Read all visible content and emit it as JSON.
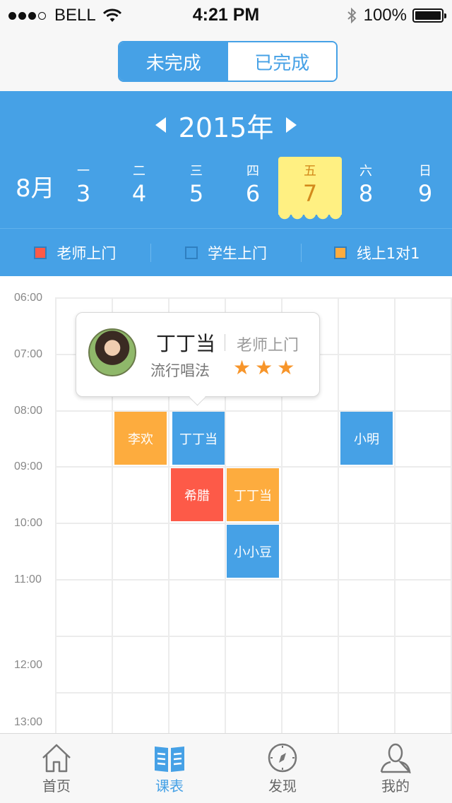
{
  "status_bar": {
    "carrier": "BELL",
    "time": "4:21 PM",
    "battery": "100%"
  },
  "segmented": {
    "options": [
      "未完成",
      "已完成"
    ],
    "selected": "未完成"
  },
  "calendar": {
    "year": "2015年",
    "month": "8月",
    "days": [
      {
        "weekday": "一",
        "date": "3"
      },
      {
        "weekday": "二",
        "date": "4"
      },
      {
        "weekday": "三",
        "date": "5"
      },
      {
        "weekday": "四",
        "date": "6"
      },
      {
        "weekday": "五",
        "date": "7"
      },
      {
        "weekday": "六",
        "date": "8"
      },
      {
        "weekday": "日",
        "date": "9"
      }
    ],
    "selected_day": "7"
  },
  "legend": [
    {
      "label": "老师上门",
      "color": "#fd5a48"
    },
    {
      "label": "学生上门",
      "color": "#46a1e6"
    },
    {
      "label": "线上1对1",
      "color": "#fdac3e"
    }
  ],
  "schedule": {
    "times": [
      "06:00",
      "07:00",
      "08:00",
      "09:00",
      "10:00",
      "11:00",
      "12:00",
      "13:00"
    ],
    "events": [
      {
        "name": "李欢",
        "type": "线上1对1",
        "color": "#fdac3e"
      },
      {
        "name": "丁丁当",
        "type": "学生上门",
        "color": "#46a1e6"
      },
      {
        "name": "小明",
        "type": "学生上门",
        "color": "#46a1e6"
      },
      {
        "name": "希腊",
        "type": "老师上门",
        "color": "#fd5a48"
      },
      {
        "name": "丁丁当",
        "type": "线上1对1",
        "color": "#fdac3e"
      },
      {
        "name": "小小豆",
        "type": "学生上门",
        "color": "#46a1e6"
      }
    ]
  },
  "popup": {
    "name": "丁丁当",
    "type": "老师上门",
    "course": "流行唱法",
    "rating": 3
  },
  "tabbar": {
    "tabs": [
      {
        "label": "首页",
        "icon": "home-icon"
      },
      {
        "label": "课表",
        "icon": "schedule-book-icon"
      },
      {
        "label": "发现",
        "icon": "compass-icon"
      },
      {
        "label": "我的",
        "icon": "user-icon"
      }
    ],
    "active": "课表"
  }
}
